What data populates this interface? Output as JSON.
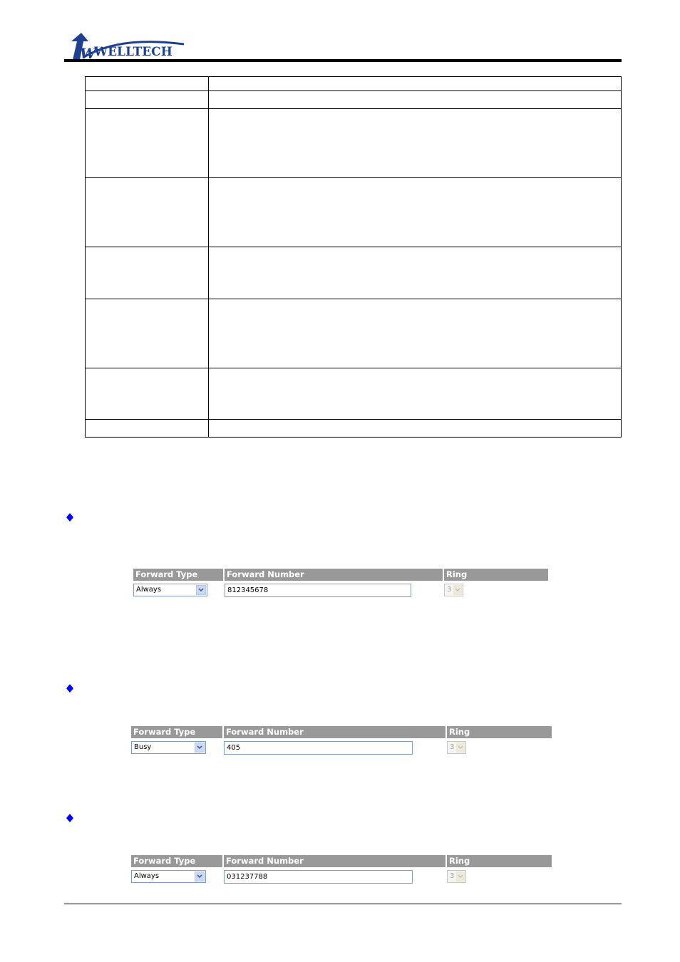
{
  "header": {
    "brand": "WELLTECH",
    "logo_mark": "W"
  },
  "description_table": {
    "rows": [
      {
        "label": "",
        "description": ""
      },
      {
        "label": "",
        "description": ""
      },
      {
        "label": "",
        "description": ""
      },
      {
        "label": "",
        "description": ""
      },
      {
        "label": "",
        "description": ""
      },
      {
        "label": "",
        "description": ""
      },
      {
        "label": "",
        "description": ""
      },
      {
        "label": "",
        "description": ""
      }
    ]
  },
  "colors": {
    "bullet": "#0000ff",
    "form_header_bg": "#999999",
    "input_border": "#7f9db9",
    "brand_blue": "#1f3f8f"
  },
  "forms": [
    {
      "headers": {
        "forward_type": "Forward Type",
        "forward_number": "Forward Number",
        "ring": "Ring"
      },
      "forward_type": "Always",
      "forward_number": "812345678",
      "ring": "3"
    },
    {
      "headers": {
        "forward_type": "Forward Type",
        "forward_number": "Forward Number",
        "ring": "Ring"
      },
      "forward_type": "Busy",
      "forward_number": "405",
      "ring": "3"
    },
    {
      "headers": {
        "forward_type": "Forward Type",
        "forward_number": "Forward Number",
        "ring": "Ring"
      },
      "forward_type": "Always",
      "forward_number": "031237788",
      "ring": "3"
    }
  ]
}
